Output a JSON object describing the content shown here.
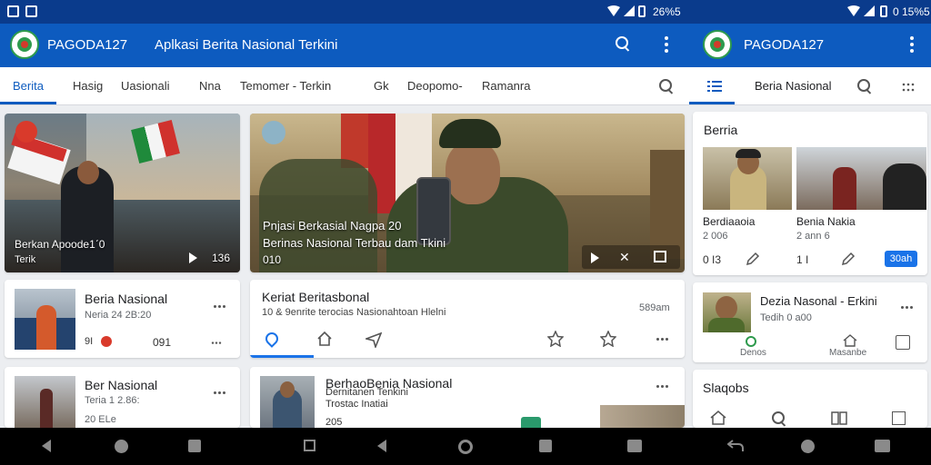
{
  "status_bar": {
    "time_left": "26%5",
    "time_right": "0 15%5"
  },
  "left_app": {
    "app_name": "PAGODA127",
    "header_title": "Aplkasi Berita Nasional   Terkini",
    "tabs": [
      "Berita",
      "Hasig",
      "Uasionali",
      "Nna",
      "Temomer - Terkin",
      "Gk",
      "Deopomo-",
      "Ramanra"
    ],
    "active_tab": "Berita",
    "hero_left": {
      "caption_line1": "Berkan Apoode1ˊ0",
      "caption_line2": "Terik",
      "duration": "136"
    },
    "hero_right": {
      "caption_line1": "Pnjasi Berkasial Nagpa 20",
      "caption_line2": "Berinas Nasional Terbau dam Tkini",
      "caption_line3": "010"
    },
    "list_left": [
      {
        "title": "Beria Nasional",
        "subtitle": "Neria 24 2B:20",
        "meta_left": "9I",
        "meta_mid": "091",
        "more": "···"
      },
      {
        "title": "Ber Nasional",
        "subtitle": "Teria 1 2.86:",
        "meta_left": "20 ELe",
        "more": "···"
      }
    ],
    "feature_card": {
      "title": "Keriat Beritasbonal",
      "meta": "10 & 9enrite terocias Nasionahtoan Hlelni",
      "badge": "589am"
    },
    "second_card": {
      "title": "BerhaoBenia Nasional",
      "line2": "Dernitanen Tenkini",
      "line3": "Trostac Inatiai",
      "meta": "205"
    }
  },
  "right_app": {
    "app_name": "PAGODA127",
    "active_tab": "Beria Nasional",
    "section1_title": "Berria",
    "tiles": [
      {
        "title": "Berdiaaoia",
        "subtitle": "2 006",
        "meta": "0 I3"
      },
      {
        "title": "Benia Nakia",
        "subtitle": "2 ann 6",
        "meta": "1 I"
      }
    ],
    "share_button": "30ah",
    "list_item": {
      "title": "Dezia Nasonal - Erkini",
      "subtitle": "Tedih 0 a00",
      "action1": "Denos",
      "action2": "Masanbe"
    },
    "section2_title": "Slaqobs"
  },
  "colors": {
    "status_bar": "#0a3b8c",
    "app_bar": "#0d5bbf",
    "accent": "#1a73e8",
    "nav_bar": "#000000"
  }
}
